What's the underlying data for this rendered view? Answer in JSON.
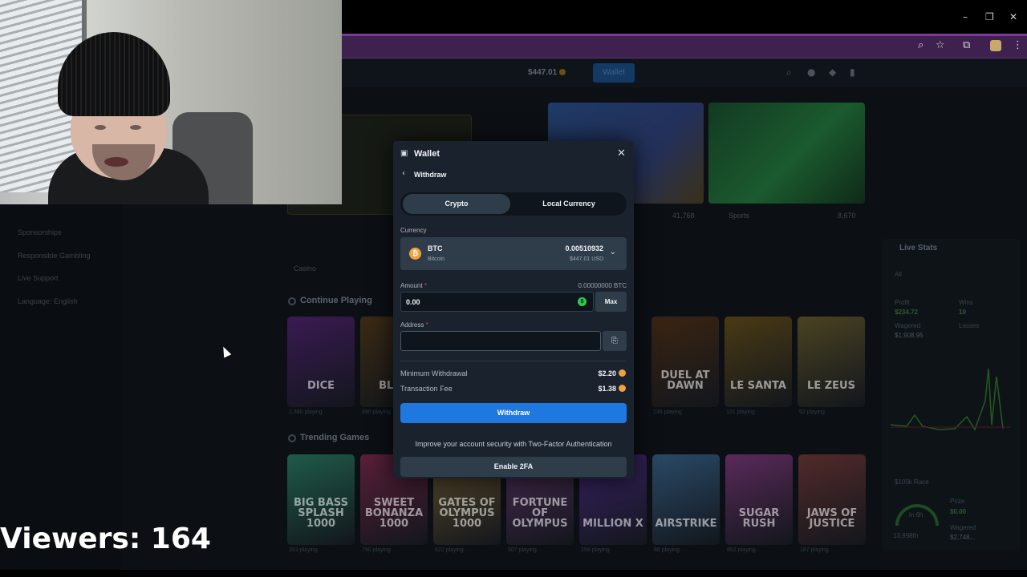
{
  "stream": {
    "viewers_label": "Viewers: 164"
  },
  "browser": {
    "window_controls": [
      "–",
      "❐",
      "✕"
    ]
  },
  "site_header": {
    "balance": "$447.01",
    "wallet_label": "Wallet"
  },
  "sidebar": {
    "items": [
      {
        "label": "Sponsorships"
      },
      {
        "label": "Responsible Gambling"
      },
      {
        "label": "Live Support"
      },
      {
        "label": "Language: English"
      }
    ]
  },
  "banners": [
    {
      "count": "41,768"
    },
    {
      "label": "Sports",
      "count": "8,670"
    }
  ],
  "filter": {
    "category": "Casino"
  },
  "continue_playing": {
    "title": "Continue Playing",
    "games": [
      {
        "name": "DICE",
        "players": "2,380 playing",
        "color": "#3a1a52"
      },
      {
        "name": "BLAC",
        "players": "690 playing",
        "color": "#3b2a14"
      },
      {
        "name": "DUEL AT DAWN",
        "players": "136 playing",
        "color": "#3a2412"
      },
      {
        "name": "LE SANTA",
        "players": "121 playing",
        "color": "#4a3a14"
      },
      {
        "name": "LE ZEUS",
        "players": "52 playing",
        "color": "#4a4222"
      }
    ]
  },
  "trending": {
    "title": "Trending Games",
    "games": [
      {
        "name": "BIG BASS SPLASH 1000",
        "players": "283 playing",
        "color": "#1f5a4a"
      },
      {
        "name": "SWEET BONANZA 1000",
        "players": "790 playing",
        "color": "#5a1f3a"
      },
      {
        "name": "GATES OF OLYMPUS 1000",
        "players": "622 playing",
        "color": "#5a4a2a"
      },
      {
        "name": "FORTUNE OF OLYMPUS",
        "players": "507 playing",
        "color": "#4a2a52"
      },
      {
        "name": "MILLION X",
        "players": "159 playing",
        "color": "#3a2266"
      },
      {
        "name": "AIRSTRIKE",
        "players": "88 playing",
        "color": "#2a4a66"
      },
      {
        "name": "SUGAR RUSH",
        "players": "852 playing",
        "color": "#5a2a5a"
      },
      {
        "name": "JAWS OF JUSTICE",
        "players": "187 playing",
        "color": "#522a2a"
      }
    ]
  },
  "live_stats": {
    "title": "Live Stats",
    "filter": "All",
    "profit_label": "Profit",
    "profit_value": "$234.72",
    "wins_label": "Wins",
    "wins_value": "10",
    "wagered_label": "Wagered",
    "wagered_value": "$1,908.95",
    "losses_label": "Losses",
    "race_label": "$100k Race",
    "race_time": "in 6h",
    "race_rank": "13,998th",
    "prize_label": "Prize",
    "prize_value": "$0.00",
    "race_wagered_label": "Wagered",
    "race_wagered_value": "$2,748..."
  },
  "wallet_modal": {
    "title": "Wallet",
    "subtitle": "Withdraw",
    "tabs": [
      "Crypto",
      "Local Currency"
    ],
    "currency_label": "Currency",
    "currency": {
      "code": "BTC",
      "name": "Bitcoin",
      "balance": "0.00510932",
      "balance_usd": "$447.01 USD",
      "logo_glyph": "₿"
    },
    "amount_label": "Amount",
    "amount_hint": "0.00000000 BTC",
    "amount_value": "0.00",
    "max_label": "Max",
    "address_label": "Address",
    "address_value": "",
    "min_withdrawal_label": "Minimum Withdrawal",
    "min_withdrawal_value": "$2.20",
    "fee_label": "Transaction Fee",
    "fee_value": "$1.38",
    "withdraw_button": "Withdraw",
    "security_text": "Improve your account security with Two-Factor Authentication",
    "enable_2fa_button": "Enable 2FA"
  },
  "colors": {
    "accent_blue": "#1f78e0",
    "modal_bg": "#1a232d",
    "browser_tab_purple": "#3f2150",
    "btc_orange": "#f2a23a",
    "usd_green": "#2ecb49"
  }
}
